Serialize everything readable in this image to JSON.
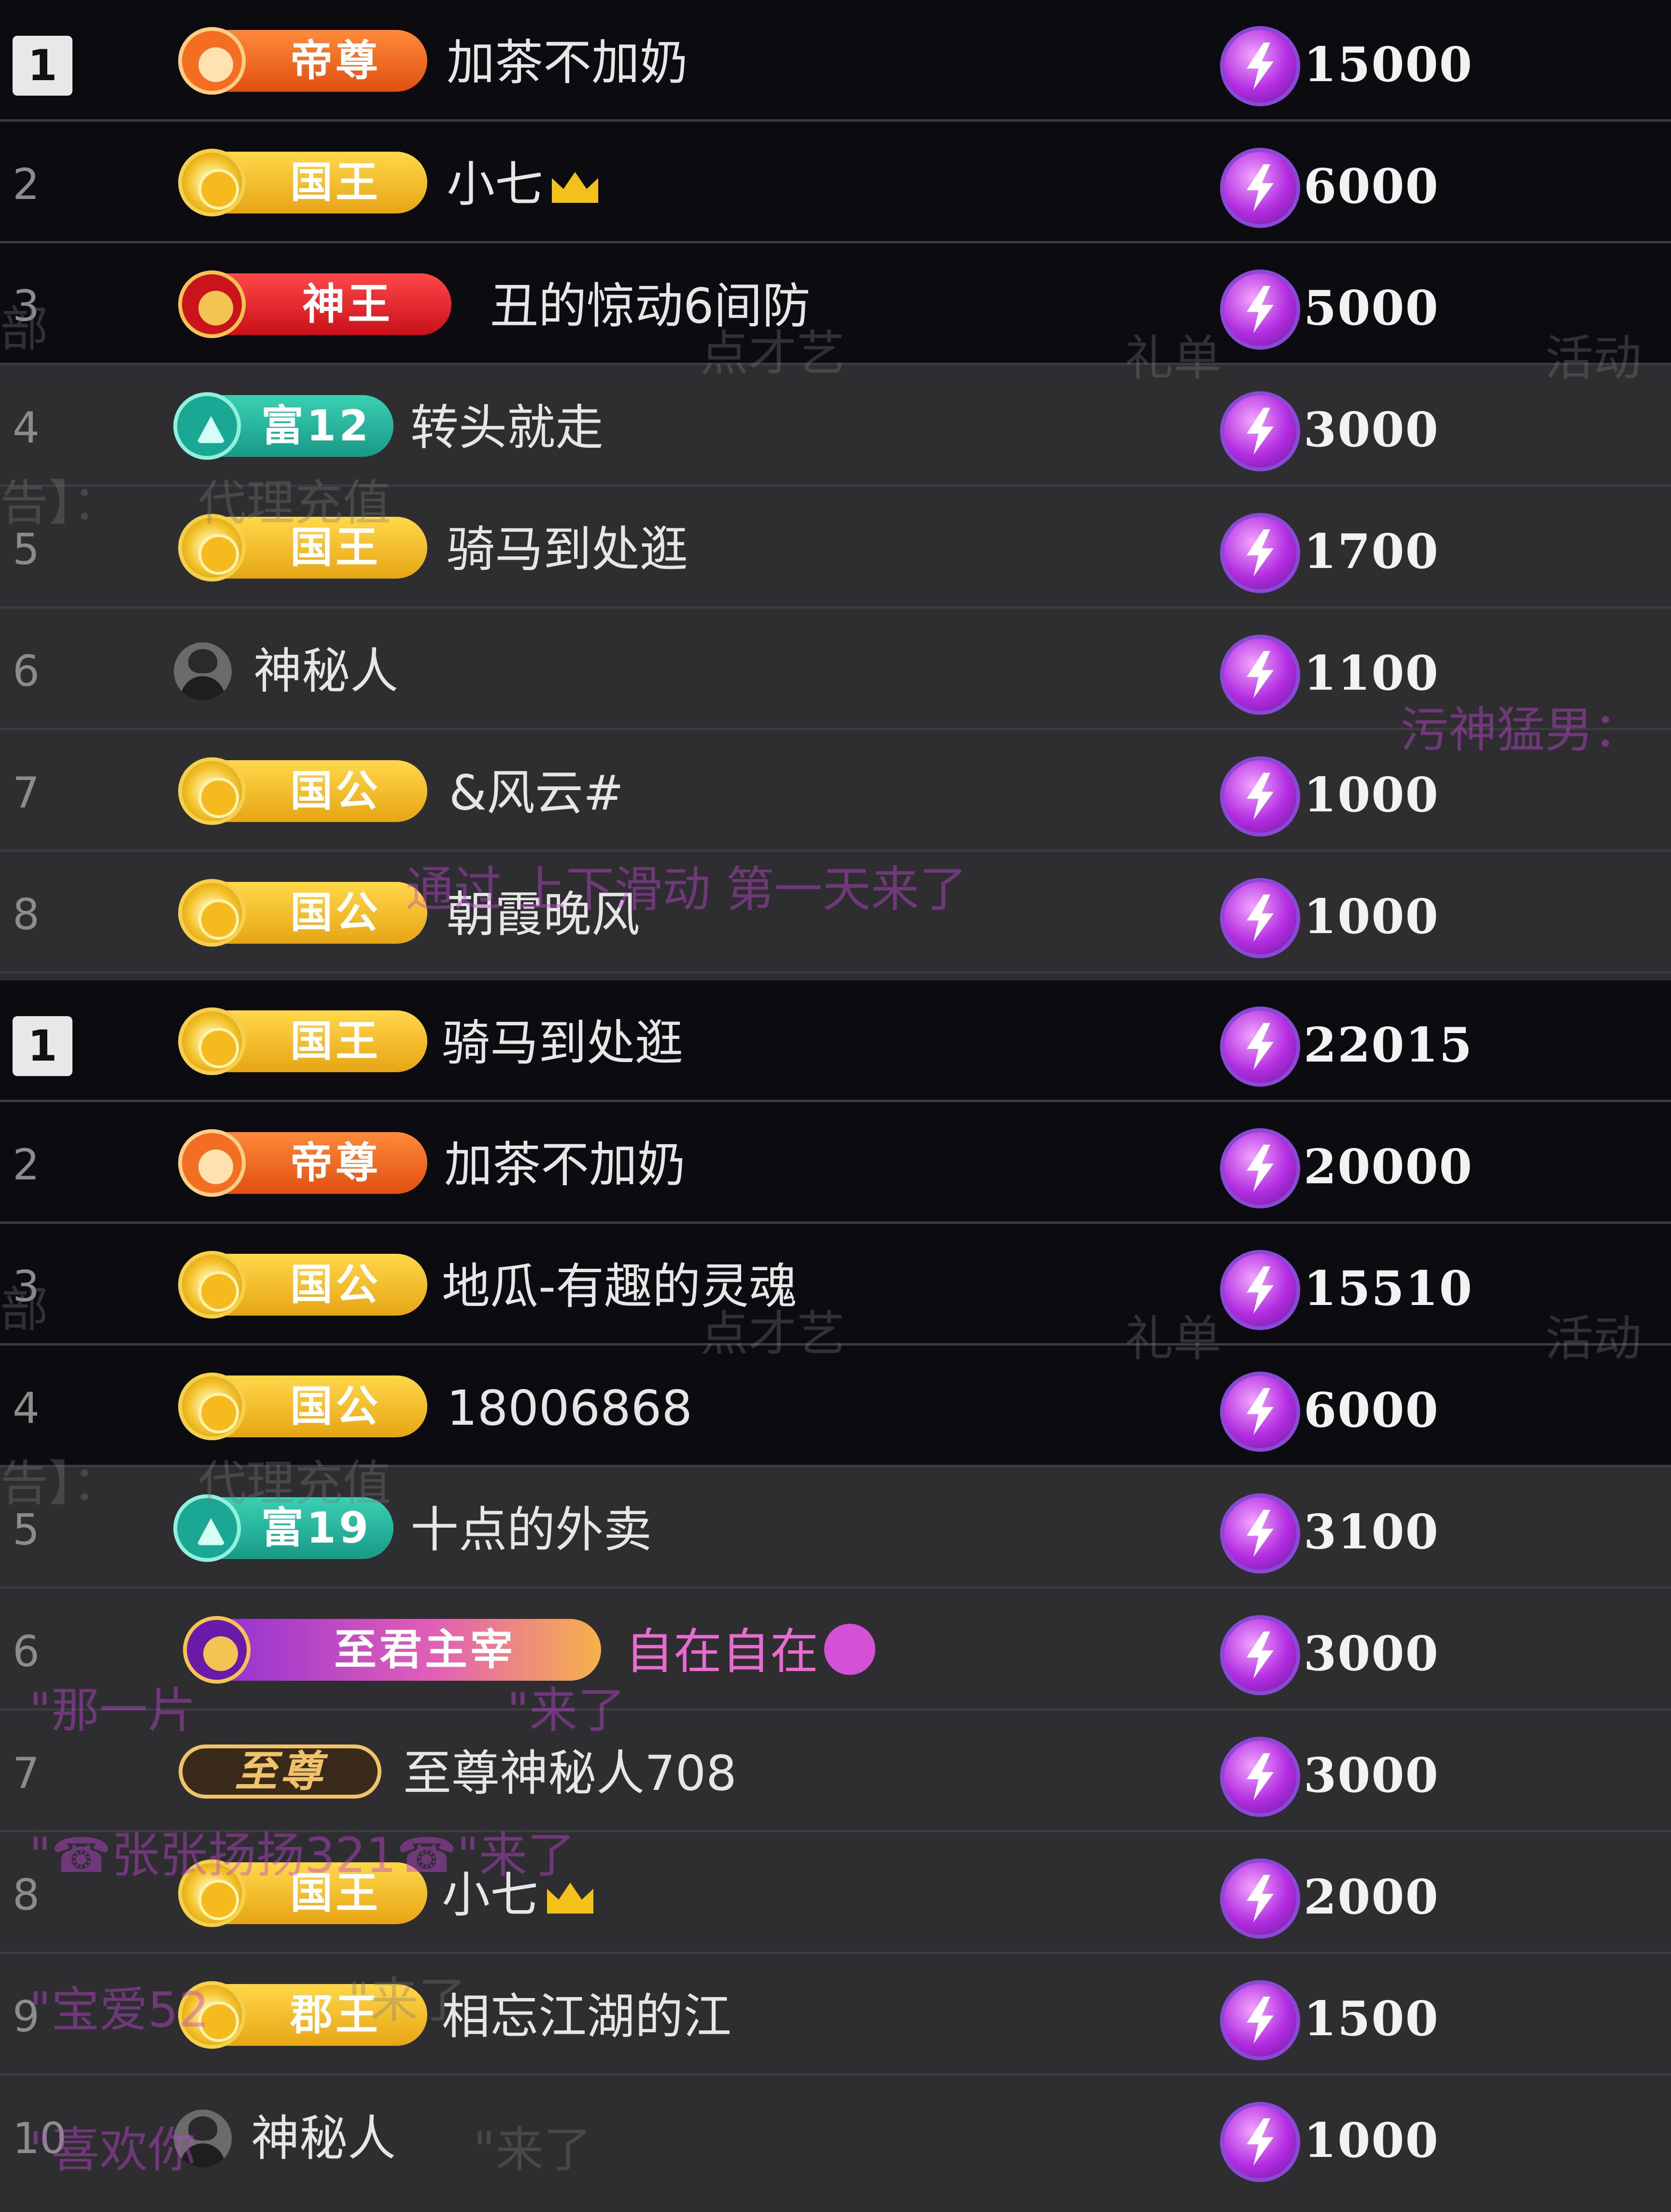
{
  "colors": {
    "panel_dark": "#0b0b10",
    "panel_light": "#2e2e31",
    "gift_purple": "#b22de0",
    "vip_pink": "#e86ccf"
  },
  "ghost_text": {
    "t1": "部",
    "t2": "礼单",
    "t3": "活动",
    "t4": "点才艺",
    "t5": "告】：",
    "t6": "代理充值",
    "t7": "污神猛男：",
    "t8": "通过 上下滑动 第一天来了",
    "t9": "部",
    "t10": "礼单",
    "t11": "活动",
    "t12": "点才艺",
    "t13": "告】：",
    "t14": "代理充值",
    "t15": "\"那一片",
    "t16": "\"来了",
    "t17": "\"☎张张扬扬321☎\"来了",
    "t18": "\"宝爱52",
    "t19": "\"来了",
    "t20": "\"喜欢你",
    "t21": "\"来了"
  },
  "leaderboard_top": [
    {
      "rank": "1",
      "badge": "帝尊",
      "badge_style": "orange",
      "name": "加茶不加奶",
      "gift_icon": "lightning-icon",
      "value": "15000"
    },
    {
      "rank": "2",
      "badge": "国王",
      "badge_style": "gold",
      "name": "小七",
      "crown": true,
      "gift_icon": "lightning-icon",
      "value": "6000"
    },
    {
      "rank": "3",
      "badge": "神王",
      "badge_style": "red",
      "name": "丑的惊动6间防",
      "gift_icon": "lightning-icon",
      "value": "5000"
    },
    {
      "rank": "4",
      "badge": "富12",
      "badge_style": "teal",
      "name": "转头就走",
      "gift_icon": "lightning-icon",
      "value": "3000"
    },
    {
      "rank": "5",
      "badge": "国王",
      "badge_style": "gold",
      "name": "骑马到处逛",
      "gift_icon": "lightning-icon",
      "value": "1700"
    },
    {
      "rank": "6",
      "badge": "",
      "badge_style": "avatar",
      "name": "神秘人",
      "gift_icon": "lightning-icon",
      "value": "1100"
    },
    {
      "rank": "7",
      "badge": "国公",
      "badge_style": "gold",
      "name": "&风云#",
      "gift_icon": "lightning-icon",
      "value": "1000"
    },
    {
      "rank": "8",
      "badge": "国公",
      "badge_style": "gold",
      "name": "朝霞晚风",
      "gift_icon": "lightning-icon",
      "value": "1000"
    }
  ],
  "leaderboard_bottom": [
    {
      "rank": "1",
      "badge": "国王",
      "badge_style": "gold",
      "name": "骑马到处逛",
      "gift_icon": "lightning-icon",
      "value": "22015"
    },
    {
      "rank": "2",
      "badge": "帝尊",
      "badge_style": "orange",
      "name": "加茶不加奶",
      "gift_icon": "lightning-icon",
      "value": "20000"
    },
    {
      "rank": "3",
      "badge": "国公",
      "badge_style": "gold",
      "name": "地瓜-有趣的灵魂",
      "gift_icon": "lightning-icon",
      "value": "15510"
    },
    {
      "rank": "4",
      "badge": "国公",
      "badge_style": "gold",
      "name": "18006868",
      "gift_icon": "lightning-icon",
      "value": "6000"
    },
    {
      "rank": "5",
      "badge": "富19",
      "badge_style": "teal",
      "name": "十点的外卖",
      "gift_icon": "lightning-icon",
      "value": "3100"
    },
    {
      "rank": "6",
      "badge": "至君主宰",
      "badge_style": "purple",
      "name": "自在自在",
      "pink": true,
      "gift_icon": "lightning-icon",
      "value": "3000"
    },
    {
      "rank": "7",
      "badge": "至尊",
      "badge_style": "dark",
      "name": "至尊神秘人708",
      "gift_icon": "lightning-icon",
      "value": "3000"
    },
    {
      "rank": "8",
      "badge": "国王",
      "badge_style": "gold",
      "name": "小七",
      "crown": true,
      "gift_icon": "lightning-icon",
      "value": "2000"
    },
    {
      "rank": "9",
      "badge": "郡王",
      "badge_style": "gold",
      "name": "相忘江湖的江",
      "gift_icon": "lightning-icon",
      "value": "1500"
    },
    {
      "rank": "10",
      "badge": "",
      "badge_style": "avatar",
      "name": "神秘人",
      "gift_icon": "lightning-icon",
      "value": "1000"
    }
  ]
}
